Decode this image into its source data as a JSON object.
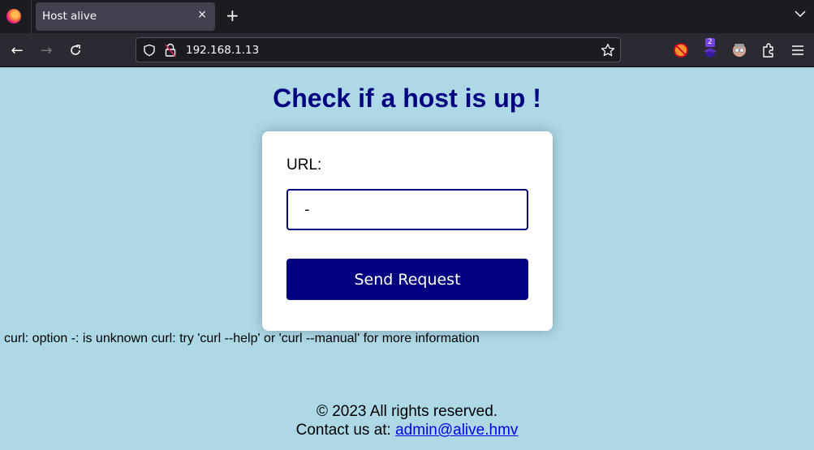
{
  "browser": {
    "tab": {
      "title": "Host alive",
      "close_glyph": "×"
    },
    "new_tab_glyph": "+",
    "address": "192.168.1.13",
    "extension_badge": "2",
    "icons": {
      "back": "←",
      "forward": "→",
      "reload": "↻"
    }
  },
  "page": {
    "title": "Check if a host is up !",
    "form": {
      "url_label": "URL:",
      "url_value": "-",
      "submit_label": "Send Request"
    },
    "result": "curl: option -: is unknown curl: try 'curl --help' or 'curl --manual' for more information",
    "footer": {
      "copyright": "© 2023 All rights reserved.",
      "contact_prefix": "Contact us at: ",
      "contact_email": "admin@alive.hmv"
    }
  },
  "colors": {
    "page_bg": "#add8e6",
    "accent": "#000080",
    "link": "#0000ee"
  }
}
